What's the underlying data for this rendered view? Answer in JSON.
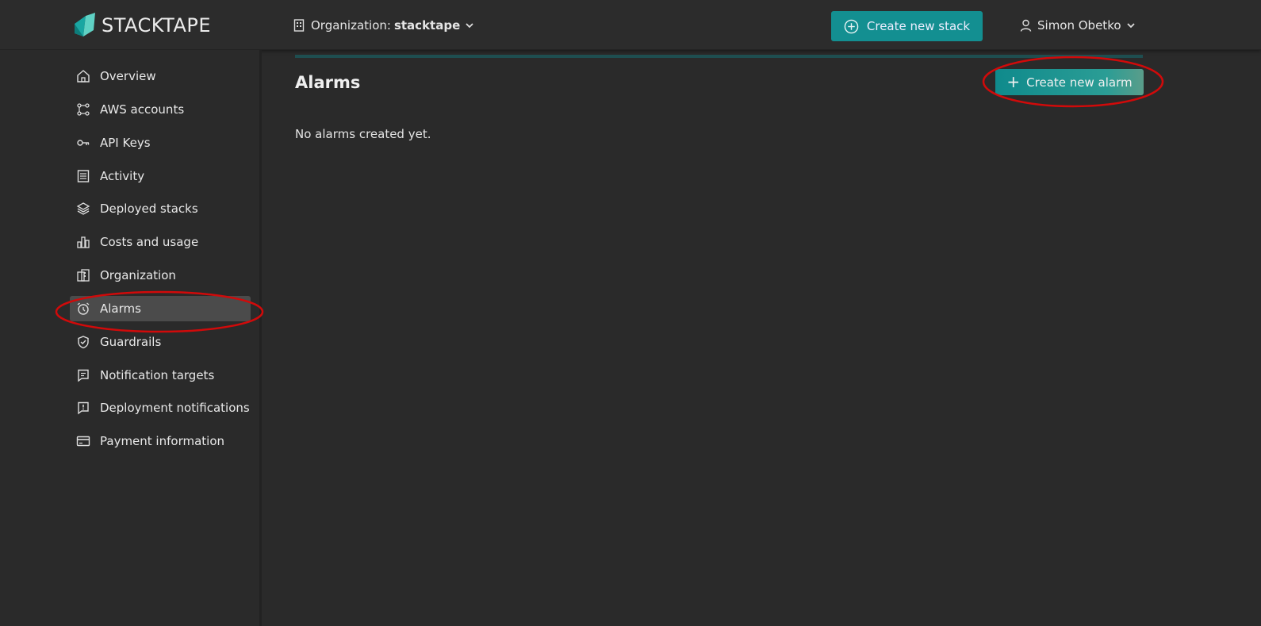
{
  "app": {
    "logo_text": "STACKTAPE"
  },
  "header": {
    "org_label": "Organization:",
    "org_name": "stacktape",
    "create_stack_label": "Create new stack",
    "user_name": "Simon Obetko"
  },
  "sidebar": {
    "items": [
      {
        "label": "Overview",
        "icon": "home-icon"
      },
      {
        "label": "AWS accounts",
        "icon": "network-icon"
      },
      {
        "label": "API Keys",
        "icon": "key-icon"
      },
      {
        "label": "Activity",
        "icon": "list-icon"
      },
      {
        "label": "Deployed stacks",
        "icon": "layers-icon"
      },
      {
        "label": "Costs and usage",
        "icon": "bar-chart-icon"
      },
      {
        "label": "Organization",
        "icon": "building-icon"
      },
      {
        "label": "Alarms",
        "icon": "alarm-clock-icon",
        "active": true
      },
      {
        "label": "Guardrails",
        "icon": "shield-check-icon"
      },
      {
        "label": "Notification targets",
        "icon": "message-icon"
      },
      {
        "label": "Deployment notifications",
        "icon": "alert-message-icon"
      },
      {
        "label": "Payment information",
        "icon": "credit-card-icon"
      }
    ]
  },
  "main": {
    "title": "Alarms",
    "create_alarm_label": "Create new alarm",
    "empty_text": "No alarms created yet."
  },
  "colors": {
    "accent": "#138f91",
    "annotation": "#d10a0a",
    "active_nav": "#4b4b4b"
  }
}
